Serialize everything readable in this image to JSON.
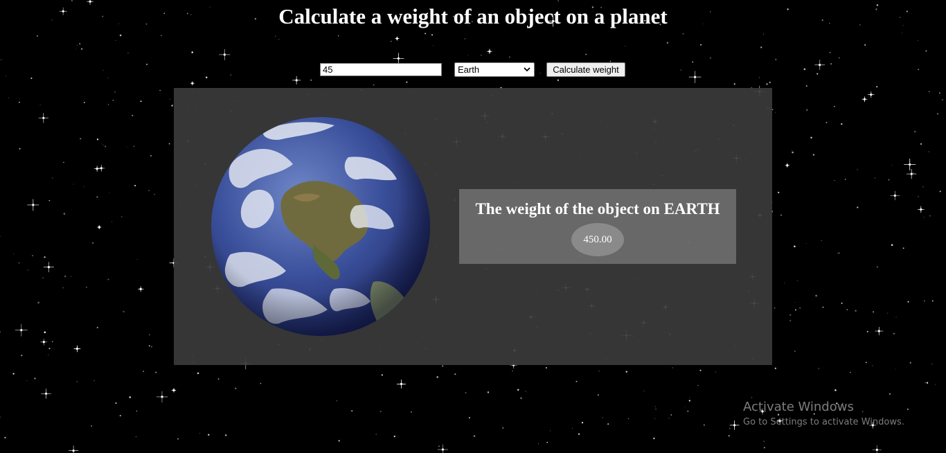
{
  "page": {
    "title": "Calculate a weight of an object on a planet"
  },
  "controls": {
    "mass_value": "45",
    "planet_selected": "Earth",
    "calculate_label": "Calculate weight"
  },
  "result": {
    "heading": "The weight of the object on EARTH",
    "value": "450.00",
    "planet_image": "earth-globe"
  },
  "watermark": {
    "title": "Activate Windows",
    "subtitle": "Go to Settings to activate Windows."
  },
  "colors": {
    "background": "#000000",
    "panel": "#3a3a3a",
    "result_box": "#6e6e6e",
    "text": "#ffffff"
  }
}
